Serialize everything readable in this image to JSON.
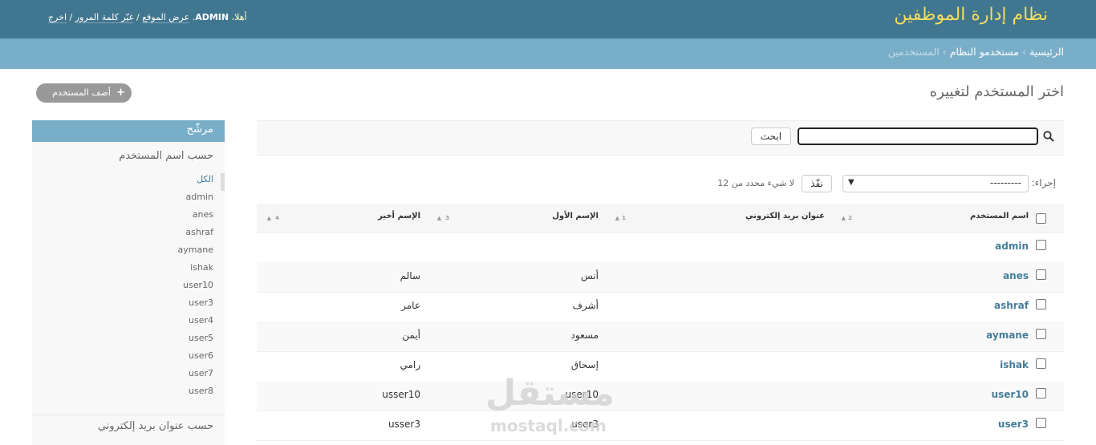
{
  "header": {
    "site_title": "نظام إدارة الموظفين",
    "welcome": "أهلا،",
    "username": "ADMIN",
    "view_site": "عرض الموقع",
    "change_password": "غيّر كلمة المرور",
    "logout": "اخرج",
    "separator": "/"
  },
  "breadcrumbs": {
    "home": "الرئيسية",
    "app": "مستخدمو النظام",
    "current": "المستخدمين",
    "sep": "›"
  },
  "content": {
    "title": "اختر المستخدم لتغييره",
    "add_button": "أضف المستخدم",
    "search_button": "ابحث",
    "search_value": "",
    "actions_label": "إجراء:",
    "action_selected": "---------",
    "go_button": "نفّذ",
    "selection_counter": "لا شيء محدد من 12"
  },
  "table": {
    "headers": {
      "username": "اسم المستخدم",
      "email": "عنوان بريد إلكتروني",
      "first_name": "الإسم الأول",
      "last_name": "الإسم أخير"
    },
    "sort_priorities": [
      "1",
      "2",
      "3",
      "4"
    ],
    "rows": [
      {
        "username": "admin",
        "first_name": "",
        "last_name": ""
      },
      {
        "username": "anes",
        "first_name": "أنس",
        "last_name": "سالم"
      },
      {
        "username": "ashraf",
        "first_name": "أشرف",
        "last_name": "عامر"
      },
      {
        "username": "aymane",
        "first_name": "مسعود",
        "last_name": "أيمن"
      },
      {
        "username": "ishak",
        "first_name": "إسحاق",
        "last_name": "رامي"
      },
      {
        "username": "user10",
        "first_name": "user10",
        "last_name": "usser10"
      },
      {
        "username": "user3",
        "first_name": "user3",
        "last_name": "usser3"
      }
    ]
  },
  "filter": {
    "title": "مرشّح",
    "by_username": "حسب اسم المستخدم",
    "items": [
      "الكل",
      "admin",
      "anes",
      "ashraf",
      "aymane",
      "ishak",
      "user10",
      "user3",
      "user4",
      "user5",
      "user6",
      "user7",
      "user8"
    ],
    "by_email": "حسب عنوان بريد إلكتروني"
  },
  "watermark": {
    "arabic": "مستقل",
    "latin": "mostaql.com"
  },
  "colors": {
    "header_bg": "#417690",
    "breadcrumb_bg": "#79aec8",
    "title_yellow": "#f5dd5d",
    "link_blue": "#447e9b"
  }
}
